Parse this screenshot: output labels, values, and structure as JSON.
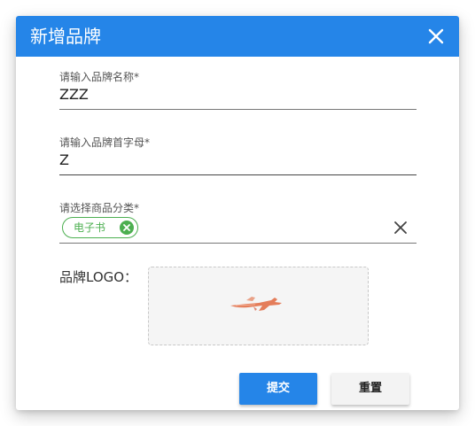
{
  "dialog": {
    "title": "新增品牌",
    "close_icon": "close-icon",
    "header_color": "#2585e8"
  },
  "form": {
    "brand_name": {
      "label": "请输入品牌名称*",
      "value": "ZZZ"
    },
    "brand_initial": {
      "label": "请输入品牌首字母*",
      "value": "Z"
    },
    "category": {
      "label": "请选择商品分类*",
      "chips": [
        {
          "label": "电子书",
          "remove_icon": "close-circle-icon"
        }
      ],
      "clear_icon": "close-icon",
      "chip_color": "#4caf50"
    },
    "logo": {
      "label": "品牌LOGO：",
      "image_icon": "airplane-logo-icon"
    }
  },
  "actions": {
    "submit_label": "提交",
    "reset_label": "重置"
  }
}
